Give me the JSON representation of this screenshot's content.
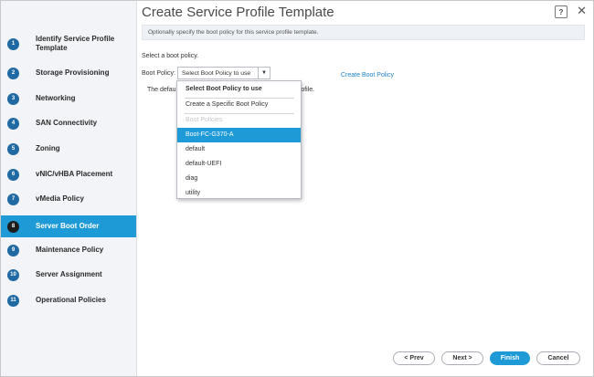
{
  "dialog": {
    "title": "Create Service Profile Template"
  },
  "help_icon": "?",
  "close_icon": "✕",
  "sidebar": {
    "steps": [
      {
        "num": "1",
        "label": "Identify Service Profile Template"
      },
      {
        "num": "2",
        "label": "Storage Provisioning"
      },
      {
        "num": "3",
        "label": "Networking"
      },
      {
        "num": "4",
        "label": "SAN Connectivity"
      },
      {
        "num": "5",
        "label": "Zoning"
      },
      {
        "num": "6",
        "label": "vNIC/vHBA Placement"
      },
      {
        "num": "7",
        "label": "vMedia Policy"
      },
      {
        "num": "8",
        "label": "Server Boot Order"
      },
      {
        "num": "9",
        "label": "Maintenance Policy"
      },
      {
        "num": "10",
        "label": "Server Assignment"
      },
      {
        "num": "11",
        "label": "Operational Policies"
      }
    ],
    "active_step": "8"
  },
  "main": {
    "info": "Optionally specify the boot policy for this service profile template.",
    "prompt": "Select a boot policy.",
    "boot_policy_label": "Boot Policy:",
    "select_value": "Select Boot Policy to use",
    "create_link": "Create Boot Policy",
    "default_text_start": "The defau",
    "default_text_end": "rofile."
  },
  "dropdown": {
    "options": [
      "Select Boot Policy to use",
      "Create a Specific Boot Policy",
      "Boot Policies",
      "Boot-FC-G370-A",
      "default",
      "default-UEFI",
      "diag",
      "utility"
    ],
    "selected": "Boot-FC-G370-A"
  },
  "buttons": {
    "prev": "< Prev",
    "next": "Next >",
    "finish": "Finish",
    "cancel": "Cancel"
  },
  "colors": {
    "accent": "#1e9ad6",
    "step_circle": "#1f6aa3",
    "link": "#1e82c8"
  }
}
